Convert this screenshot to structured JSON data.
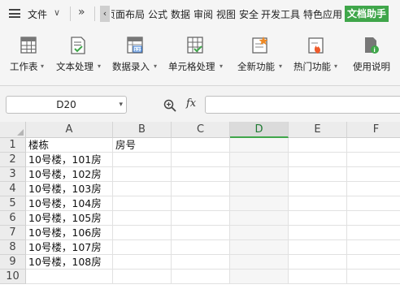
{
  "menubar": {
    "file_label": "文件",
    "file_chevron": "∨",
    "more_arrow": "»",
    "scroll_left": "‹",
    "tabs": [
      "页面布局",
      "公式",
      "数据",
      "审阅",
      "视图",
      "安全",
      "开发工具",
      "特色应用",
      "文档助手"
    ],
    "active_tab": "文档助手",
    "accent_color": "#3fa64a"
  },
  "ribbon": {
    "items": [
      {
        "label": "工作表",
        "icon": "worksheet-icon",
        "has_dropdown": true
      },
      {
        "label": "文本处理",
        "icon": "text-process-icon",
        "has_dropdown": true
      },
      {
        "label": "数据录入",
        "icon": "data-entry-icon",
        "has_dropdown": true
      },
      {
        "label": "单元格处理",
        "icon": "cell-process-icon",
        "has_dropdown": true
      },
      {
        "label": "全新功能",
        "icon": "new-feature-icon",
        "has_dropdown": true
      },
      {
        "label": "热门功能",
        "icon": "hot-feature-icon",
        "has_dropdown": true
      },
      {
        "label": "使用说明",
        "icon": "help-doc-icon",
        "has_dropdown": false
      }
    ],
    "dropdown_glyph": "▾"
  },
  "formula_bar": {
    "name_box_value": "D20",
    "name_box_chevron": "▾",
    "fx_label": "fx",
    "formula_value": ""
  },
  "sheet": {
    "columns": [
      "A",
      "B",
      "C",
      "D",
      "E",
      "F"
    ],
    "active_column": "D",
    "rows": [
      "1",
      "2",
      "3",
      "4",
      "5",
      "6",
      "7",
      "8",
      "9",
      "10"
    ],
    "cells": {
      "A1": "楼栋",
      "B1": "房号",
      "A2": "10号楼，101房",
      "A3": "10号楼，102房",
      "A4": "10号楼，103房",
      "A5": "10号楼，104房",
      "A6": "10号楼，105房",
      "A7": "10号楼，106房",
      "A8": "10号楼，107房",
      "A9": "10号楼，108房"
    }
  }
}
